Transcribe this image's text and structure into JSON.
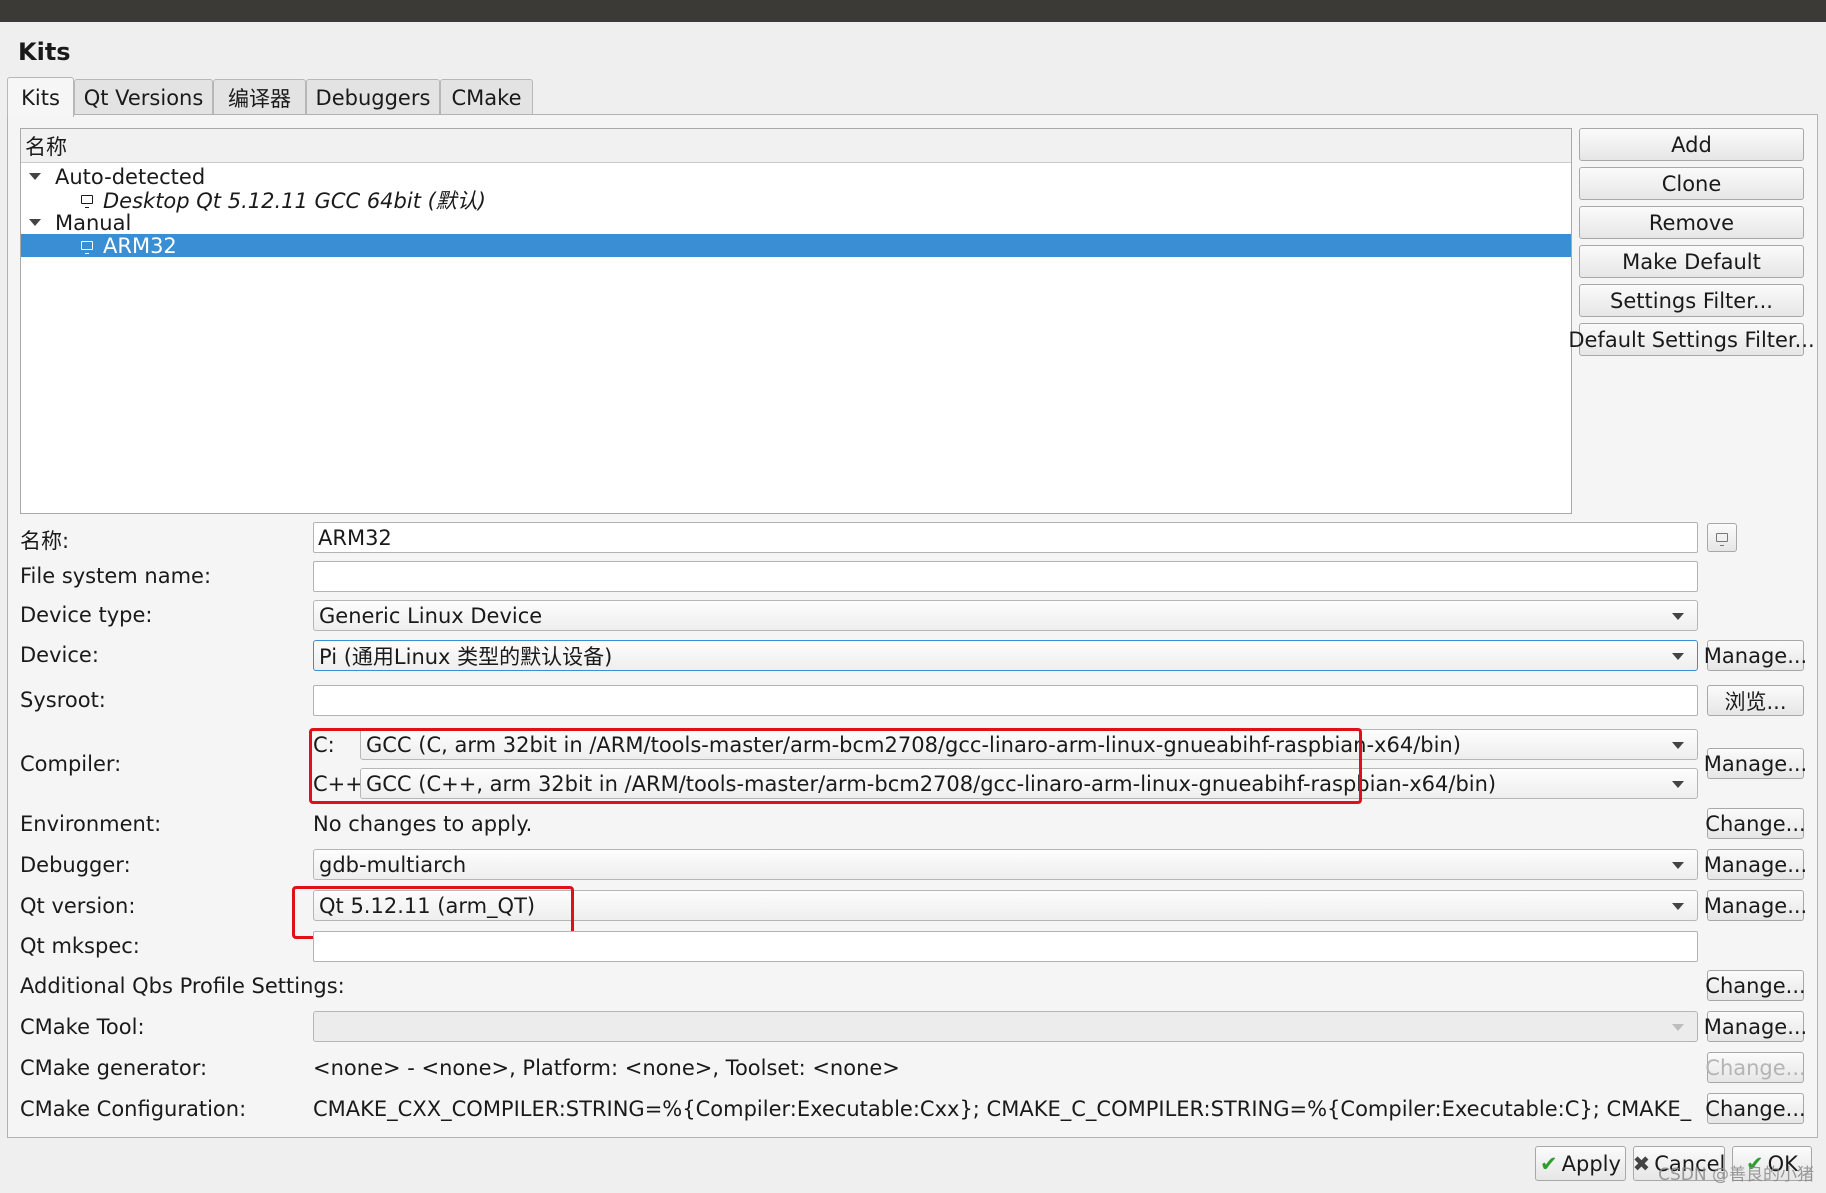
{
  "page_title": "Kits",
  "tabs": [
    {
      "label": "Kits"
    },
    {
      "label": "Qt Versions"
    },
    {
      "label": "编译器"
    },
    {
      "label": "Debuggers"
    },
    {
      "label": "CMake"
    }
  ],
  "tree": {
    "header": "名称",
    "groups": [
      {
        "label": "Auto-detected",
        "items": [
          {
            "label": "Desktop Qt 5.12.11 GCC 64bit (默认)"
          }
        ]
      },
      {
        "label": "Manual",
        "items": [
          {
            "label": "ARM32"
          }
        ]
      }
    ]
  },
  "side_buttons": {
    "add": "Add",
    "clone": "Clone",
    "remove": "Remove",
    "make_default": "Make Default",
    "settings_filter": "Settings Filter...",
    "default_settings_filter": "Default Settings Filter..."
  },
  "form": {
    "name": {
      "label": "名称:",
      "value": "ARM32"
    },
    "fs_name": {
      "label": "File system name:",
      "value": ""
    },
    "device_type": {
      "label": "Device type:",
      "value": "Generic Linux Device"
    },
    "device": {
      "label": "Device:",
      "value": "Pi (通用Linux 类型的默认设备)",
      "button": "Manage..."
    },
    "sysroot": {
      "label": "Sysroot:",
      "value": "",
      "button": "浏览..."
    },
    "compiler": {
      "label": "Compiler:",
      "c_label": "C:",
      "c_value": "GCC (C, arm 32bit in /ARM/tools-master/arm-bcm2708/gcc-linaro-arm-linux-gnueabihf-raspbian-x64/bin)",
      "cpp_label": "C++:",
      "cpp_value": "GCC (C++, arm 32bit in /ARM/tools-master/arm-bcm2708/gcc-linaro-arm-linux-gnueabihf-raspbian-x64/bin)",
      "button": "Manage..."
    },
    "environment": {
      "label": "Environment:",
      "value": "No changes to apply.",
      "button": "Change..."
    },
    "debugger": {
      "label": "Debugger:",
      "value": "gdb-multiarch",
      "button": "Manage..."
    },
    "qt_version": {
      "label": "Qt version:",
      "value": "Qt 5.12.11 (arm_QT)",
      "button": "Manage..."
    },
    "qt_mkspec": {
      "label": "Qt mkspec:",
      "value": ""
    },
    "qbs": {
      "label": "Additional Qbs Profile Settings:",
      "button": "Change..."
    },
    "cmake_tool": {
      "label": "CMake Tool:",
      "value": "",
      "button": "Manage..."
    },
    "cmake_generator": {
      "label": "CMake generator:",
      "value": "<none> - <none>, Platform: <none>, Toolset: <none>",
      "button": "Change..."
    },
    "cmake_config": {
      "label": "CMake Configuration:",
      "value": "CMAKE_CXX_COMPILER:STRING=%{Compiler:Executable:Cxx}; CMAKE_C_COMPILER:STRING=%{Compiler:Executable:C}; CMAKE_PREFIX_PATH:STRIN…",
      "button": "Change..."
    }
  },
  "dialog_buttons": {
    "apply": "Apply",
    "cancel": "Cancel",
    "ok": "OK"
  },
  "watermark": "CSDN @善良的小猪",
  "colors": {
    "selection": "#3a8ed3",
    "highlight_box": "#e0101a"
  }
}
